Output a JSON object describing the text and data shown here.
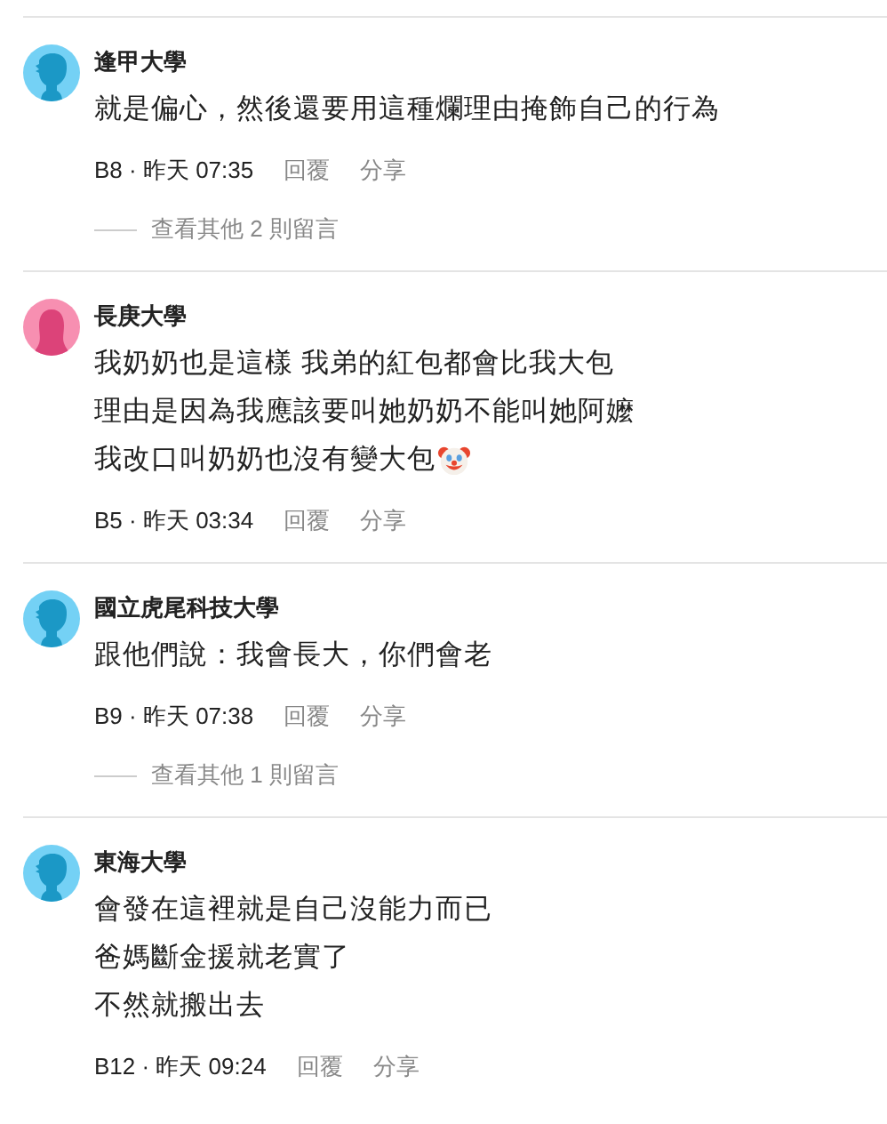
{
  "comments": [
    {
      "avatar": {
        "kind": "male"
      },
      "author": "逢甲大學",
      "lines": [
        "就是偏心，然後還要用這種爛理由掩飾自己的行為"
      ],
      "post_info": "B8 · 昨天 07:35",
      "actions": [
        "回覆",
        "分享"
      ],
      "more_replies": "查看其他 2 則留言"
    },
    {
      "avatar": {
        "kind": "female"
      },
      "author": "長庚大學",
      "lines": [
        "我奶奶也是這樣 我弟的紅包都會比我大包",
        "理由是因為我應該要叫她奶奶不能叫她阿嬤",
        "我改口叫奶奶也沒有變大包"
      ],
      "emoji": {
        "kind": "clown"
      },
      "post_info": "B5 · 昨天 03:34",
      "actions": [
        "回覆",
        "分享"
      ]
    },
    {
      "avatar": {
        "kind": "male"
      },
      "author": "國立虎尾科技大學",
      "lines": [
        "跟他們說：我會長大，你們會老"
      ],
      "post_info": "B9 · 昨天 07:38",
      "actions": [
        "回覆",
        "分享"
      ],
      "more_replies": "查看其他 1 則留言"
    },
    {
      "avatar": {
        "kind": "male"
      },
      "author": "東海大學",
      "lines": [
        "會發在這裡就是自己沒能力而已",
        "爸媽斷金援就老實了",
        "不然就搬出去"
      ],
      "post_info": "B12 · 昨天 09:24",
      "actions": [
        "回覆",
        "分享"
      ]
    }
  ]
}
